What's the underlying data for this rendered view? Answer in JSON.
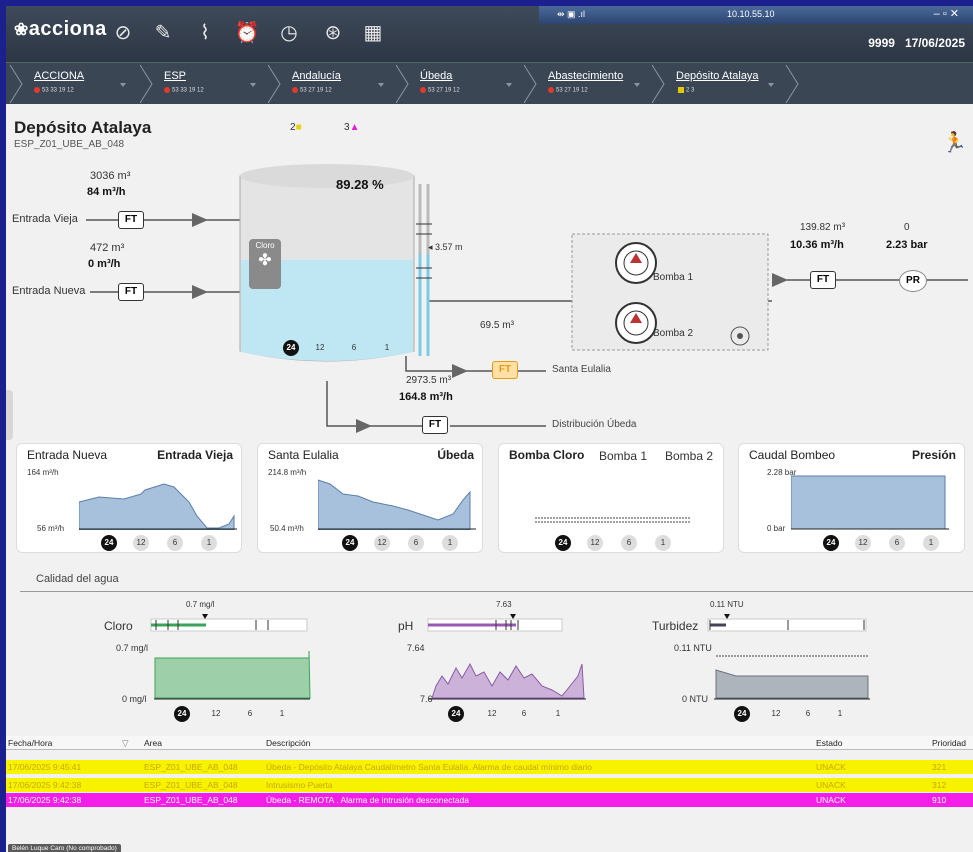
{
  "app": {
    "logo": "acciona",
    "user_id": "9999",
    "date": "17/06/2025",
    "ip": "10.10.55.10"
  },
  "breadcrumbs": [
    {
      "label": "ACCIONA",
      "stats": "53 33 19 12"
    },
    {
      "label": "ESP",
      "stats": "53 33 19 12"
    },
    {
      "label": "Andalucía",
      "stats": "53 27 19 12"
    },
    {
      "label": "Úbeda",
      "stats": "53 27 19 12"
    },
    {
      "label": "Abastecimiento",
      "stats": "53 27 19 12"
    },
    {
      "label": "Depósito Atalaya",
      "stats": "2 3"
    }
  ],
  "page": {
    "title": "Depósito Atalaya",
    "code": "ESP_Z01_UBE_AB_048",
    "alarm_yellow": "2",
    "alarm_magenta": "3"
  },
  "diagram": {
    "tank_level": "89.28 %",
    "tank_height": "3.57 m",
    "cloro": "Cloro",
    "entrada_vieja": {
      "label": "Entrada Vieja",
      "volume": "3036 m³",
      "flow": "84 m³/h",
      "tag": "FT"
    },
    "entrada_nueva": {
      "label": "Entrada Nueva",
      "volume": "472 m³",
      "flow": "0 m³/h",
      "tag": "FT"
    },
    "santa_eulalia": {
      "label": "Santa Eulalia",
      "volume": "69.5 m³",
      "tag": "FT"
    },
    "distribucion": {
      "label": "Distribución Úbeda",
      "volume": "2973.5 m³",
      "flow": "164.8 m³/h",
      "tag": "FT"
    },
    "bomba1": "Bomba 1",
    "bomba2": "Bomba 2",
    "out_flow": {
      "volume": "139.82 m³",
      "flow": "10.36 m³/h",
      "tag": "FT"
    },
    "pressure": {
      "volume": "0",
      "value": "2.23 bar",
      "tag": "PR"
    },
    "ranges": [
      "24",
      "12",
      "6",
      "1"
    ],
    "level_fraction": 0.8928
  },
  "cards": [
    {
      "h1": "Entrada Nueva",
      "h2": "Entrada Vieja",
      "ymax": "164 m³/h",
      "ymin": "56 m³/h"
    },
    {
      "h1": "Santa Eulalia",
      "h2": "Úbeda",
      "ymax": "214.8 m³/h",
      "ymin": "50.4 m³/h"
    },
    {
      "h1": "Bomba Cloro",
      "h2a": "Bomba 1",
      "h2b": "Bomba 2"
    },
    {
      "h1": "Caudal Bombeo",
      "h2": "Presión",
      "ymax": "2.28 bar",
      "ymin": "0 bar"
    }
  ],
  "quality": {
    "section": "Calidad del agua",
    "cloro": {
      "label": "Cloro",
      "marker": "0.7 mg/l",
      "ymax": "0.7 mg/l",
      "ymin": "0 mg/l"
    },
    "ph": {
      "label": "pH",
      "marker": "7.63",
      "ymax": "7.64",
      "ymin": "7.6"
    },
    "turbidez": {
      "label": "Turbidez",
      "marker": "0.11 NTU",
      "ymax": "0.11 NTU",
      "ymin": "0 NTU"
    }
  },
  "table": {
    "headers": [
      "Fecha/Hora",
      "Area",
      "Descripción",
      "Estado",
      "Prioridad"
    ],
    "rows": [
      {
        "date": "17/06/2025 9:45:41",
        "area": "ESP_Z01_UBE_AB_048",
        "desc": "Úbeda - Depósito Atalaya Caudalímetro Santa Eulalia. Alarma de caudal mínimo diario",
        "state": "UNACK",
        "prio": "321"
      },
      {
        "date": "17/06/2025 9:42:38",
        "area": "ESP_Z01_UBE_AB_048",
        "desc": "Intrusismo Puerta",
        "state": "UNACK",
        "prio": "312"
      },
      {
        "date": "17/06/2025 9:42:38",
        "area": "ESP_Z01_UBE_AB_048",
        "desc": "Úbeda - REMOTA . Alarma de intrusión desconectada",
        "state": "UNACK",
        "prio": "910"
      }
    ]
  },
  "footer": {
    "user": "Belén Luque Caro (No comprobado)"
  },
  "colors": {
    "water": "#bfe6f3",
    "alarm_yellow": "#f7f200",
    "alarm_magenta": "#f41ee8",
    "cloro_green": "#7cc08d",
    "ph_purple": "#b89ac4",
    "turb_gray": "#8e9aa8"
  }
}
